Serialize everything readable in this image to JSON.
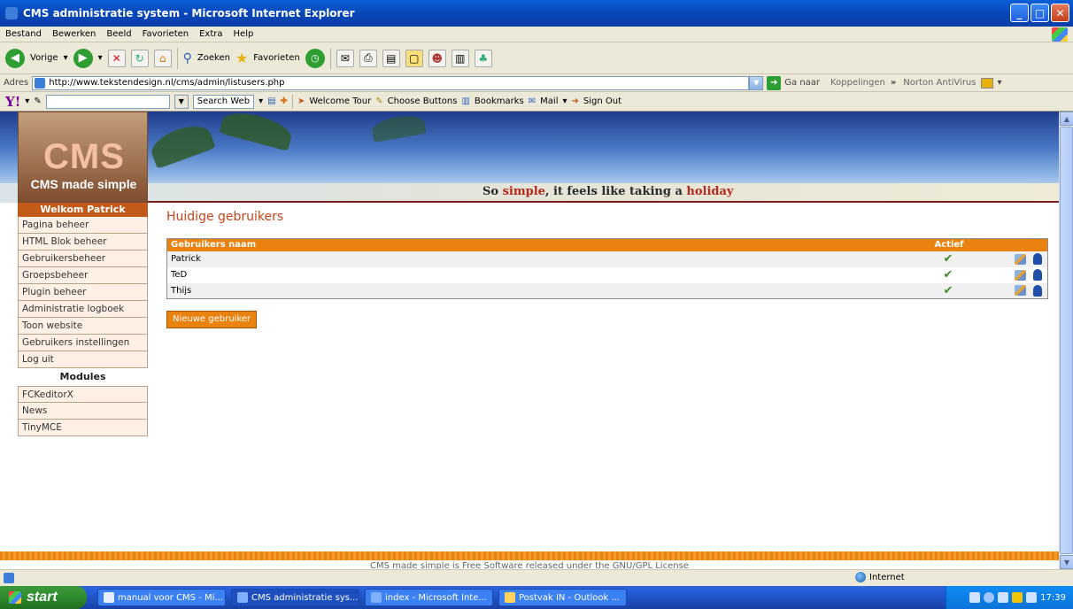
{
  "window": {
    "title": "CMS administratie system - Microsoft Internet Explorer"
  },
  "menu": [
    "Bestand",
    "Bewerken",
    "Beeld",
    "Favorieten",
    "Extra",
    "Help"
  ],
  "toolbar": {
    "back_label": "Vorige",
    "search_label": "Zoeken",
    "favorites_label": "Favorieten"
  },
  "address": {
    "label": "Adres",
    "url": "http://www.tekstendesign.nl/cms/admin/listusers.php",
    "go_label": "Ga naar",
    "links_label": "Koppelingen",
    "norton_label": "Norton AntiVirus"
  },
  "yahoo": {
    "search_web": "Search Web",
    "welcome_tour": "Welcome Tour",
    "choose_buttons": "Choose Buttons",
    "bookmarks": "Bookmarks",
    "mail": "Mail",
    "sign_out": "Sign Out"
  },
  "banner": {
    "logo_text": "CMS",
    "logo_sub": "CMS made simple",
    "tagline_pre": "So ",
    "tagline_simple": "simple",
    "tagline_mid": ", it feels like taking a ",
    "tagline_holiday": "holiday"
  },
  "sidebar": {
    "welcome": "Welkom Patrick",
    "items": [
      "Pagina beheer",
      "HTML Blok beheer",
      "Gebruikersbeheer",
      "Groepsbeheer",
      "Plugin beheer",
      "Administratie logboek",
      "Toon website",
      "Gebruikers instellingen",
      "Log uit"
    ],
    "modules_heading": "Modules",
    "modules": [
      "FCKeditorX",
      "News",
      "TinyMCE"
    ]
  },
  "main": {
    "title": "Huidige gebruikers",
    "table": {
      "col_name": "Gebruikers naam",
      "col_active": "Actief",
      "rows": [
        {
          "name": "Patrick",
          "active": true
        },
        {
          "name": "TeD",
          "active": true
        },
        {
          "name": "Thijs",
          "active": true
        }
      ]
    },
    "new_user_button": "Nieuwe gebruiker",
    "footer": "CMS made simple is Free Software released under the GNU/GPL License"
  },
  "status": {
    "zone": "Internet"
  },
  "taskbar": {
    "start": "start",
    "tasks": [
      "manual voor CMS - Mi...",
      "CMS administratie sys...",
      "index - Microsoft Inte...",
      "Postvak IN - Outlook ..."
    ],
    "active_task": 1,
    "clock": "17:39"
  },
  "colors": {
    "accent_orange": "#e9820f",
    "title_red": "#c4461a",
    "check_green": "#3d8b2b"
  }
}
